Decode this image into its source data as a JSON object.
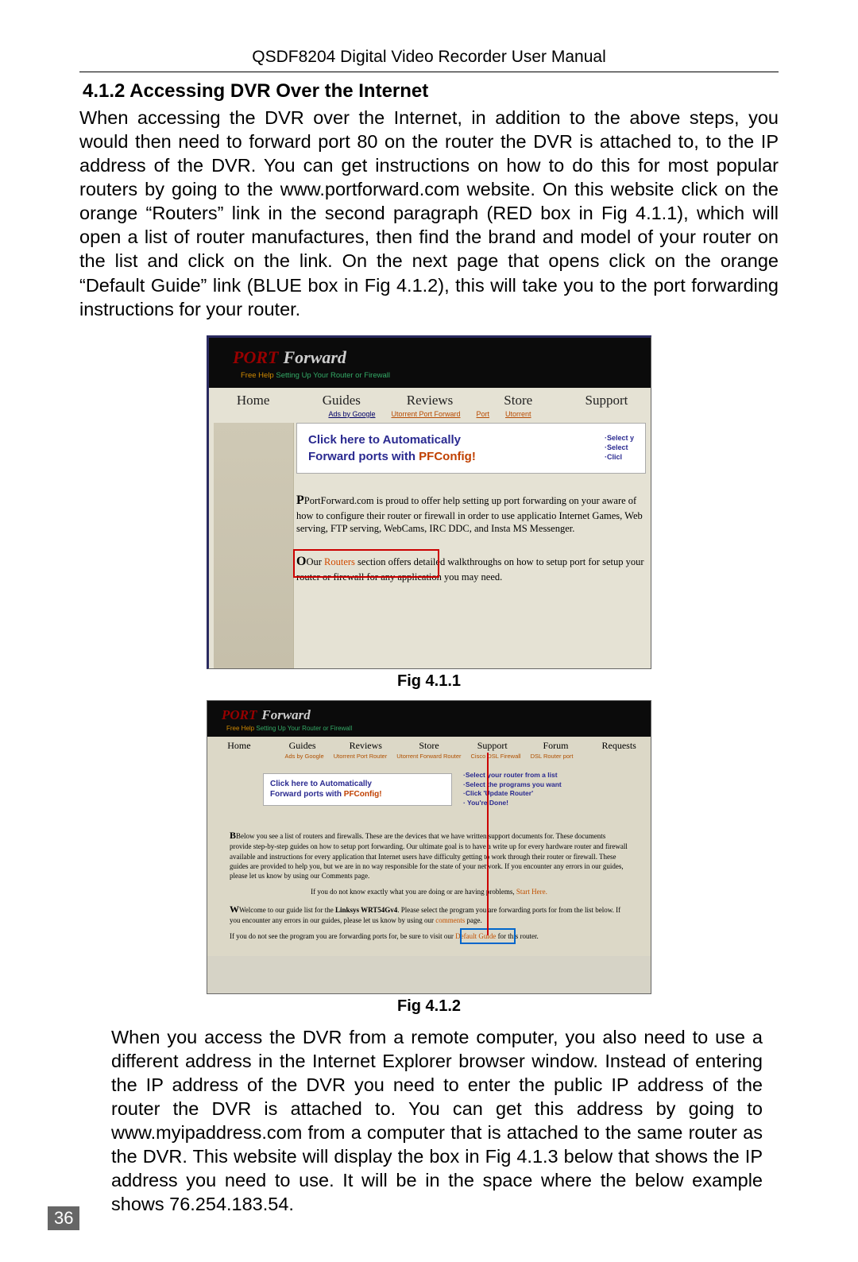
{
  "manual_title": "QSDF8204 Digital Video Recorder User Manual",
  "section": {
    "number_title": "4.1.2 Accessing DVR Over the Internet"
  },
  "para1": "When accessing the DVR over the Internet, in addition to the above steps, you would then need to forward port 80 on the router the DVR is attached to, to the IP address of the DVR. You can get instructions on how to do this for most popular routers by going to the www.portforward.com website. On this website click on the orange “Routers” link in the second paragraph (RED box in Fig 4.1.1), which will open a list of router manufactures, then find the brand and model of your router on the list and click on the link. On the next page that opens click on the orange “Default Guide” link (BLUE box in Fig 4.1.2), this will take you to the port forwarding instructions for your router.",
  "para2": "When you access the DVR from a remote computer, you also need to use a different address in the Internet Explorer browser window. Instead of entering the IP address of the DVR you need to enter the public IP address of the router the DVR is attached to. You can get this address by going to www.myipaddress.com from a computer that is attached to the same router as the DVR. This website will display the box in Fig 4.1.3 below that shows the IP address you need to use. It will be in the space where the below example shows 76.254.183.54.",
  "page_number": "36",
  "fig1": {
    "caption": "Fig 4.1.1",
    "logo_port": "PORT",
    "logo_forward": "Forward",
    "tagline_free": "Free Help",
    "tagline_rest": "Setting Up Your Router or Firewall",
    "nav": [
      "Home",
      "Guides",
      "Reviews",
      "Store",
      "Support"
    ],
    "subnav_label": "Ads by Google",
    "subnav_links": [
      "Utorrent Port Forward",
      "Port",
      "Utorrent"
    ],
    "promo_line1": "Click here to Automatically",
    "promo_line2_a": "Forward ports with ",
    "promo_line2_b": "PFConfig!",
    "promo_side": "·Select y\n·Select\n·Clicl",
    "p1": "PortForward.com is proud to offer help setting up port forwarding on your aware of how to configure their router or firewall in order to use applicatio Internet Games, Web serving, FTP serving, WebCams, IRC DDC, and Insta MS Messenger.",
    "p2_a": "Our ",
    "p2_routers": "Routers",
    "p2_b": " section offers detailed walkthroughs on how to setup port for setup your router or firewall for any application you may need."
  },
  "fig2": {
    "caption": "Fig 4.1.2",
    "logo_port": "PORT",
    "logo_forward": "Forward",
    "tagline_free": "Free Help",
    "tagline_rest": "Setting Up Your Router or Firewall",
    "nav": [
      "Home",
      "Guides",
      "Reviews",
      "Store",
      "Support",
      "Forum",
      "Requests"
    ],
    "subnav": [
      "Ads by Google",
      "Utorrent Port Router",
      "Utorrent Forward Router",
      "Cisco DSL Firewall",
      "DSL Router port"
    ],
    "promo_line1": "Click here to Automatically",
    "promo_line2_a": "Forward ports with ",
    "promo_line2_b": "PFConfig!",
    "steps": "·Select your router from a list\n·Select the programs you want\n·Click 'Update Router'\n· You're Done!",
    "t1": "Below you see a list of routers and firewalls. These are the devices that we have written support documents for. These documents provide step-by-step guides on how to setup port forwarding. Our ultimate goal is to have a write up for every hardware router and firewall available and instructions for every application that Internet users have difficulty getting to work through their router or firewall. These guides are provided to help you, but we are in no way responsible for the state of your network. If you encounter any errors in our guides, please let us know by using our Comments page.",
    "t2_a": "If you do not know exactly what you are doing or are having problems, ",
    "t2_b": "Start Here.",
    "t3_a": "Welcome to our guide list for the ",
    "t3_b": "Linksys WRT54Gv4",
    "t3_c": ". Please select the program you are forwarding ports for from the list below. If you encounter any errors in our guides, please let us know by using our ",
    "t3_d": "comments",
    "t3_e": " page.",
    "t4_a": "If you do not see the program you are forwarding ports for, be sure to visit our ",
    "t4_b": "Default Guide",
    "t4_c": " for this router."
  }
}
